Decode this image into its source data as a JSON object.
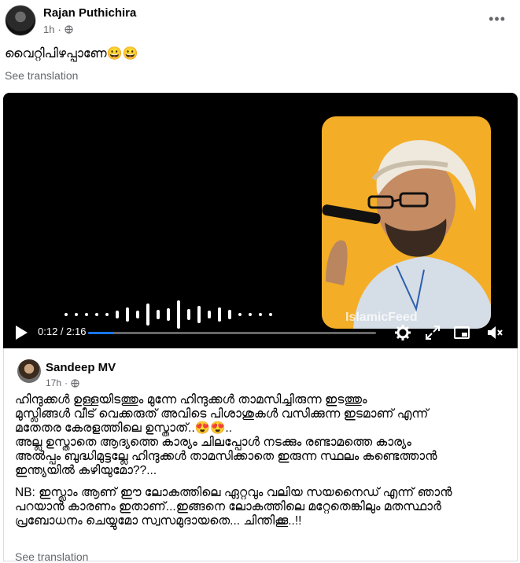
{
  "post": {
    "author": "Rajan Puthichira",
    "time": "1h",
    "more_icon": "more-horizontal-icon",
    "text": "വൈറ്റിപിഴപ്പാണേ😀😀",
    "see_translation": "See translation"
  },
  "video": {
    "watermark": "IslamicFeed",
    "current_time": "0:12 / 2:16",
    "progress": 0.09,
    "controls": [
      "play-icon",
      "settings-icon",
      "expand-icon",
      "pip-icon",
      "volume-mute-icon"
    ]
  },
  "shared": {
    "author": "Sandeep MV",
    "time": "17h",
    "lines": [
      "ഹിന്ദുക്കൾ ഉള്ളയിടത്തും മുന്നേ ഹിന്ദുക്കൾ താമസിച്ചിരുന്ന ഇടത്തും",
      "മുസ്ലിങ്ങൾ വീട് വെക്കരുത് അവിടെ പിശാശുകൾ വസിക്കുന്ന ഇടമാണ് എന്ന്",
      "മതേതര കേരളത്തിലെ ഉസ്താത്..😍😍..",
      "അല്ല ഉസ്താതെ ആദ്യത്തെ കാര്യം ചിലപ്പോൾ നടക്കും രണ്ടാമത്തെ കാര്യം",
      "അൽപ്പം ബുദ്ധിമുട്ടല്ലേ ഹിന്ദുക്കൾ താമസിക്കാതെ ഇരുന്ന സ്ഥലം കണ്ടെത്താൻ",
      "ഇന്ത്യയിൽ കഴിയുമോ??...",
      "NB: ഇസ്ലാം ആണ് ഈ ലോകത്തിലെ ഏറ്റവും വലിയ സയനൈഡ് എന്ന് ഞാൻ",
      "പറയാൻ കാരണം ഇതാണ്...ഇങ്ങനെ ലോകത്തിലെ മറ്റേതെങ്കിലും മതസ്ഥാർ",
      "പ്രബോധനം ചെയ്യുമോ സ്വസമുദായതെ... ചിന്തിക്കൂ..!!"
    ],
    "see_translation": "See translation"
  },
  "colors": {
    "accent": "#1877f2",
    "meta": "#65676b",
    "thumb_bg": "#f4ad27"
  }
}
